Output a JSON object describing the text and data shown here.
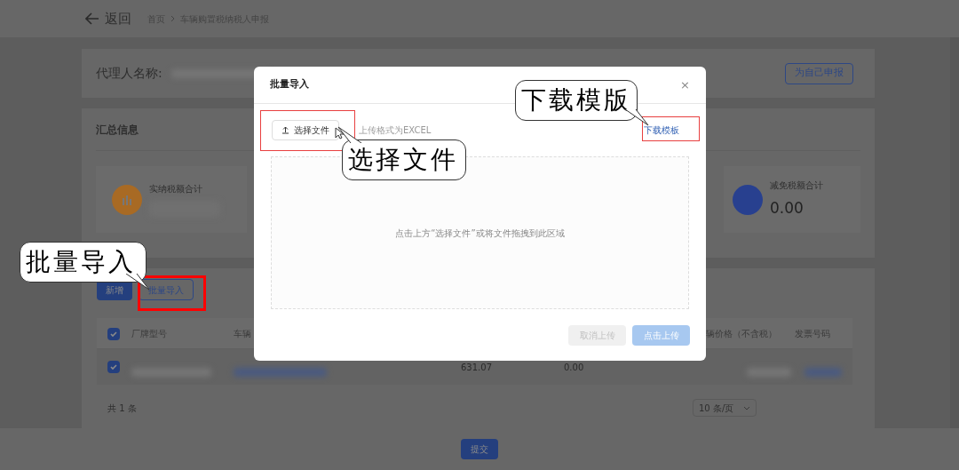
{
  "header": {
    "back": "返回",
    "breadcrumb": [
      "首页",
      "车辆购置税纳税人申报"
    ]
  },
  "agent": {
    "label": "代理人名称:",
    "button": "为自己申报"
  },
  "summary": {
    "title": "汇总信息",
    "stats": [
      {
        "label": "实纳税额合计",
        "color": "#a86a24"
      },
      {
        "label": "减免税额合计",
        "value": "0.00",
        "color": "#28408f"
      }
    ]
  },
  "list": {
    "buttons": [
      {
        "label": "新增",
        "kind": "primary"
      },
      {
        "label": "批量导入",
        "kind": "outline"
      }
    ],
    "table": {
      "header_checked": true,
      "columns": [
        "厂牌型号",
        "车辆",
        "辆价格（不含税）",
        "发票号码"
      ],
      "rows": [
        {
          "checked": true,
          "cells": [
            "631.07",
            "0.00"
          ]
        }
      ]
    },
    "total": "共 1 条",
    "page_size": "10 条/页"
  },
  "submit": "提交",
  "dialog": {
    "title": "批量导入",
    "close": "×",
    "choose_button": "选择文件",
    "hint": "上传格式为EXCEL",
    "template_link": "下载模板",
    "drop_text": "点击上方“选择文件”或将文件拖拽到此区域",
    "buttons": [
      {
        "label": "取消上传",
        "kind": "cancel",
        "disabled": true
      },
      {
        "label": "点击上传",
        "kind": "primary",
        "disabled": true
      }
    ]
  },
  "callouts": [
    "选择文件",
    "下载模版",
    "批量导入"
  ]
}
